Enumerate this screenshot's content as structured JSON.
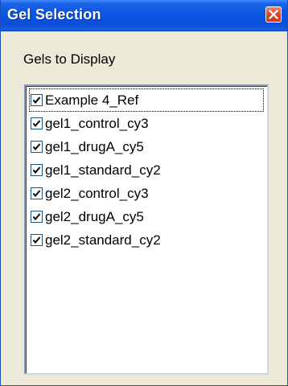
{
  "window": {
    "title": "Gel Selection",
    "close_icon": "close-x-icon"
  },
  "group": {
    "label": "Gels to Display"
  },
  "gels": {
    "items": [
      {
        "label": "Example 4_Ref",
        "checked": true
      },
      {
        "label": "gel1_control_cy3",
        "checked": true
      },
      {
        "label": "gel1_drugA_cy5",
        "checked": true
      },
      {
        "label": "gel1_standard_cy2",
        "checked": true
      },
      {
        "label": "gel2_control_cy3",
        "checked": true
      },
      {
        "label": "gel2_drugA_cy5",
        "checked": true
      },
      {
        "label": "gel2_standard_cy2",
        "checked": true
      }
    ]
  },
  "colors": {
    "titlebar": "#0a55e3",
    "close_button": "#d9462a",
    "checkmark": "#000000",
    "listbox_border": "#7f9db9"
  }
}
